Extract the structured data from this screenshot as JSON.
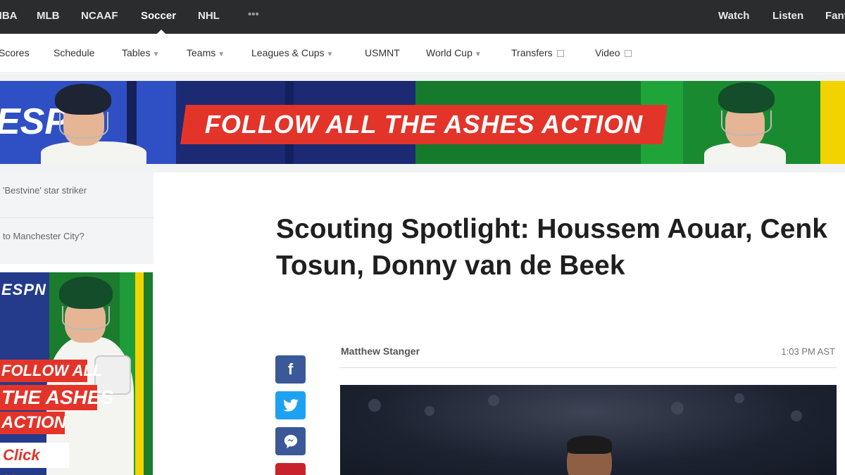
{
  "top_nav": {
    "items": [
      "NBA",
      "MLB",
      "NCAAF",
      "Soccer",
      "NHL",
      "•••"
    ],
    "active": "Soccer",
    "right_items": [
      "Watch",
      "Listen",
      "Fantasy"
    ]
  },
  "sub_nav": {
    "items": [
      {
        "label": "Scores"
      },
      {
        "label": "Schedule"
      },
      {
        "label": "Tables",
        "dropdown": true
      },
      {
        "label": "Teams",
        "dropdown": true
      },
      {
        "label": "Leagues & Cups",
        "dropdown": true
      },
      {
        "label": "USMNT"
      },
      {
        "label": "World Cup",
        "dropdown": true
      },
      {
        "label": "Transfers",
        "external": true
      },
      {
        "label": "Video",
        "external": true
      }
    ]
  },
  "banner": {
    "logo_text": "ESPN",
    "text": "FOLLOW ALL THE ASHES ACTION"
  },
  "sidebar": {
    "items": [
      {
        "text": "'Bestvine' star striker"
      },
      {
        "text": "to Manchester City?"
      }
    ],
    "ad": {
      "logo_text": "ESPN",
      "line1": "FOLLOW ALL",
      "line2": "THE ASHES",
      "line3": "ACTION",
      "cta": "Click Here"
    }
  },
  "article": {
    "headline": "Scouting Spotlight: Houssem Aouar, Cenk Tosun, Donny van de Beek",
    "author": "Matthew Stanger",
    "timestamp": "1:03 PM AST",
    "share_icons": [
      "facebook-icon",
      "twitter-icon",
      "messenger-icon",
      "pinterest-icon"
    ]
  },
  "colors": {
    "top_nav_bg": "#2b2c2d",
    "banner_red": "#e3342a",
    "facebook": "#3b5998",
    "twitter": "#1da1f2",
    "messenger": "#3b5998",
    "pinterest": "#c8232c"
  }
}
